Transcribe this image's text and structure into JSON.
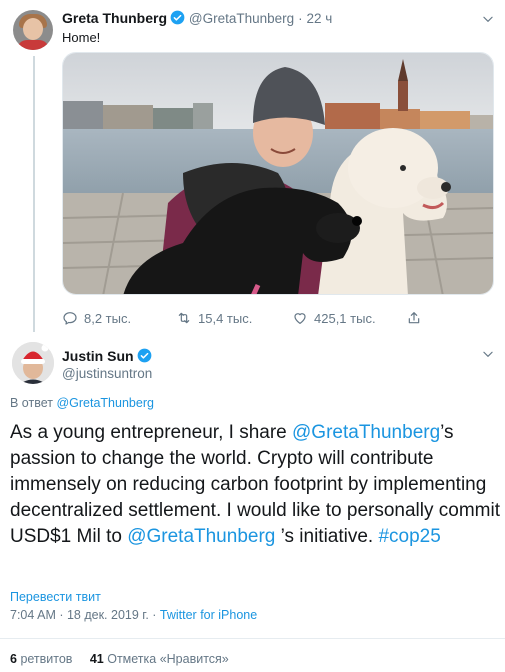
{
  "tweet1": {
    "author_name": "Greta Thunberg",
    "author_handle": "@GretaThunberg",
    "separator": "·",
    "time": "22 ч",
    "text": "Home!",
    "actions": {
      "replies": "8,2 тыс.",
      "retweets": "15,4 тыс.",
      "likes": "425,1 тыс."
    }
  },
  "tweet2": {
    "author_name": "Justin Sun",
    "author_handle": "@justinsuntron",
    "replying_prefix": "В ответ",
    "replying_to": "@GretaThunberg",
    "text_parts": {
      "p1": "As a young entrepreneur, I share ",
      "mention1": "@GretaThunberg",
      "p2": "’s passion to change the world. Crypto will contribute immensely on reducing carbon footprint by implementing decentralized settlement. I would like to personally commit USD$1 Mil to ",
      "mention2": "@GretaThunberg",
      "p3": " ’s initiative. ",
      "hashtag": "#cop25"
    },
    "translate": "Перевести твит",
    "timestamp": "7:04 AM · 18 дек. 2019 г. · ",
    "client": "Twitter for iPhone",
    "retweets_count": "6",
    "retweets_label": "ретвитов",
    "likes_count": "41",
    "likes_label": "Отметка «Нравится»"
  },
  "icons": {
    "verified": "verified-badge-icon",
    "chevron": "chevron-down-icon",
    "reply": "reply-icon",
    "retweet": "retweet-icon",
    "like": "heart-icon",
    "share": "share-icon"
  },
  "colors": {
    "link": "#1b95e0",
    "muted": "#657786",
    "text": "#14171a"
  }
}
